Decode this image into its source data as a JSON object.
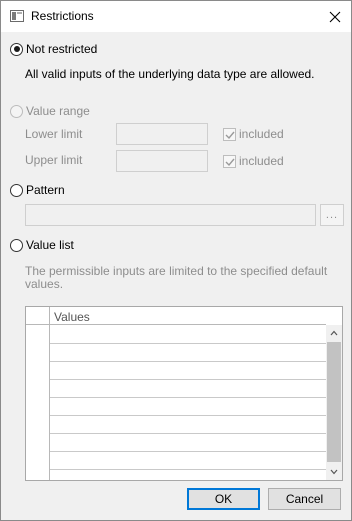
{
  "window": {
    "title": "Restrictions"
  },
  "options": {
    "not_restricted": {
      "label": "Not restricted",
      "description": "All valid inputs of the underlying data type are allowed."
    },
    "value_range": {
      "label": "Value range",
      "lower_limit_label": "Lower limit",
      "upper_limit_label": "Upper limit",
      "included_label": "included"
    },
    "pattern": {
      "label": "Pattern",
      "button_label": "..."
    },
    "value_list": {
      "label": "Value list",
      "description_line1": "The permissible inputs are limited to the specified default",
      "description_line2": "values.",
      "column_header": "Values"
    }
  },
  "buttons": {
    "ok": "OK",
    "cancel": "Cancel"
  },
  "state": {
    "selected": "not_restricted",
    "value_range_enabled": false,
    "lower_included": true,
    "upper_included": true
  },
  "colors": {
    "accent": "#0078d7",
    "disabled_text": "#8d8d8d"
  },
  "icons": {
    "window": "app-window-icon",
    "close": "close-icon",
    "checkmark": "checkmark-icon",
    "scroll_up": "chevron-up-icon",
    "scroll_down": "chevron-down-icon"
  }
}
